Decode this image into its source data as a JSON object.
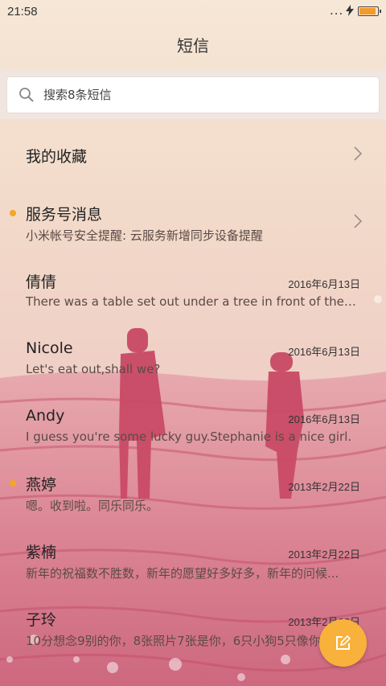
{
  "status_bar": {
    "time": "21:58",
    "dots": "...",
    "battery_level": 0.9,
    "battery_color": "#f39a2a"
  },
  "header": {
    "title": "短信"
  },
  "search": {
    "placeholder": "搜索8条短信"
  },
  "favorites": {
    "label": "我的收藏"
  },
  "service": {
    "title": "服务号消息",
    "preview": "小米帐号安全提醒: 云服务新增同步设备提醒",
    "unread": true
  },
  "conversations": [
    {
      "name": "倩倩",
      "date": "2016年6月13日",
      "preview": "There was a table set out under a tree in front of the ho...",
      "unread": false
    },
    {
      "name": "Nicole",
      "date": "2016年6月13日",
      "preview": "Let's eat out,shall we?",
      "unread": false
    },
    {
      "name": "Andy",
      "date": "2016年6月13日",
      "preview": "I guess you're some lucky guy.Stephanie is a nice girl.",
      "unread": false
    },
    {
      "name": "燕婷",
      "date": "2013年2月22日",
      "preview": "嗯。收到啦。同乐同乐。",
      "unread": true
    },
    {
      "name": "紫楠",
      "date": "2013年2月22日",
      "preview": "新年的祝福数不胜数，新年的愿望好多好多，新年的问候...",
      "unread": false
    },
    {
      "name": "子玲",
      "date": "2013年2月22日",
      "preview": "10分想念9别的你，8张照片7张是你，6只小狗5只像你...",
      "unread": false
    }
  ],
  "icons": {
    "search": "search-icon",
    "chevron": "chevron-right-icon",
    "compose": "compose-icon",
    "charging": "lightning-icon"
  },
  "colors": {
    "accent": "#f8b13a",
    "unread_dot": "#f5a623"
  }
}
